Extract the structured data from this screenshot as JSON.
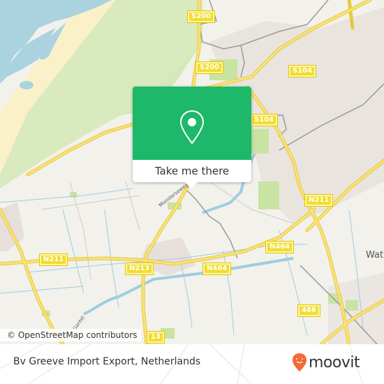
{
  "map": {
    "road_shields": [
      {
        "id": "s200-top",
        "label": "S200"
      },
      {
        "id": "s200-mid",
        "label": "S200"
      },
      {
        "id": "s104-a",
        "label": "S104"
      },
      {
        "id": "s104-b",
        "label": "S104"
      },
      {
        "id": "n211-right",
        "label": "N211"
      },
      {
        "id": "n211-left",
        "label": "N211"
      },
      {
        "id": "n213",
        "label": "N213"
      },
      {
        "id": "n464-left",
        "label": "N464"
      },
      {
        "id": "n464-right",
        "label": "N464"
      },
      {
        "id": "466",
        "label": "466"
      },
      {
        "id": "13-bottom",
        "label": "13"
      }
    ],
    "place_labels": [
      {
        "id": "wateringen",
        "label": "Wat"
      }
    ],
    "street_labels": [
      {
        "id": "street-a",
        "label": "Monsterseweg"
      },
      {
        "id": "street-b",
        "label": "Gantel"
      }
    ],
    "popup": {
      "icon": "map-pin-icon",
      "button_label": "Take me there"
    },
    "attribution": "© OpenStreetMap contributors"
  },
  "footer": {
    "location_title": "Bv Greeve Import Export, Netherlands",
    "brand": "moovit",
    "brand_color": "#f26a36"
  },
  "colors": {
    "popup_green": "#1db86a",
    "water": "#aad3df",
    "sand": "#faf1c8",
    "park": "#d2e8b3",
    "road_yellow": "#f6dd56"
  }
}
